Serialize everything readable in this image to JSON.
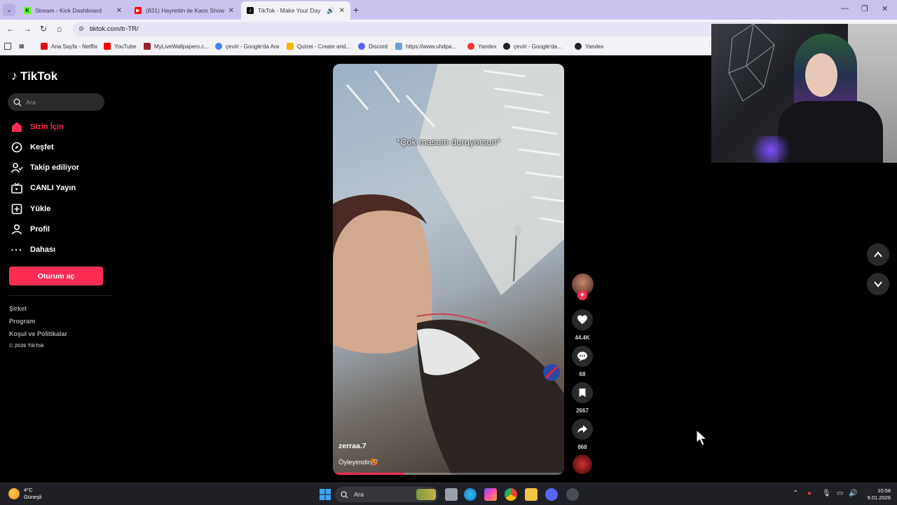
{
  "browser": {
    "tabs": [
      {
        "title": "Stream - Kick Dashboard",
        "favicon_color": "#53fc18",
        "favicon_letter": "K"
      },
      {
        "title": "(831) Hayrettin ile Kaos Show -",
        "favicon_color": "#ff0000",
        "favicon_letter": "▶"
      },
      {
        "title": "TikTok - Make Your Day",
        "favicon_color": "#111111",
        "favicon_letter": "♪"
      }
    ],
    "url": "tiktok.com/tr-TR/",
    "bookmarks": [
      {
        "label": "Ana Sayfa - Netflix",
        "color": "#e50914"
      },
      {
        "label": "YouTube",
        "color": "#ff0000"
      },
      {
        "label": "MyLiveWallpapers.c...",
        "color": "#9b1c2e"
      },
      {
        "label": "çeviri - Google'da Ara",
        "color": "#4285f4"
      },
      {
        "label": "Quizei - Create and...",
        "color": "#f5b400"
      },
      {
        "label": "Discord",
        "color": "#5865f2"
      },
      {
        "label": "https://www.uhdpa...",
        "color": "#6aa0d8"
      },
      {
        "label": "Yandex",
        "color": "#ff3333"
      },
      {
        "label": "çeviri - Google'da...",
        "color": "#222222"
      },
      {
        "label": "Yandex",
        "color": "#222222"
      }
    ]
  },
  "sidebar": {
    "logo": "TikTok",
    "search_placeholder": "Ara",
    "nav": [
      {
        "label": "Sizin İçin",
        "icon": "home-icon",
        "active": true
      },
      {
        "label": "Keşfet",
        "icon": "compass-icon",
        "active": false
      },
      {
        "label": "Takip ediliyor",
        "icon": "following-icon",
        "active": false
      },
      {
        "label": "CANLI Yayın",
        "icon": "live-icon",
        "active": false
      },
      {
        "label": "Yükle",
        "icon": "upload-icon",
        "active": false
      },
      {
        "label": "Profil",
        "icon": "profile-icon",
        "active": false
      },
      {
        "label": "Dahası",
        "icon": "more-icon",
        "active": false
      }
    ],
    "login_label": "Oturum aç",
    "footer": [
      "Şirket",
      "Program",
      "Koşul ve Politikalar"
    ],
    "copyright": "© 2026 TikTok"
  },
  "video": {
    "caption": "*Çok masum duruyorsun*",
    "username": "zerraa.7",
    "description": "Öyleyimdir🥵",
    "progress_fraction": 0.31
  },
  "actions": {
    "likes": "44.4K",
    "comments": "68",
    "saves": "2667",
    "shares": "868"
  },
  "taskbar": {
    "weather_temp": "4°C",
    "weather_desc": "Güneşli",
    "search_placeholder": "Ara",
    "time": "10:58",
    "date": "9.01.2026"
  },
  "colors": {
    "accent": "#fe2c55",
    "tabbar": "#c9c3ef",
    "page_bg": "#000000"
  }
}
